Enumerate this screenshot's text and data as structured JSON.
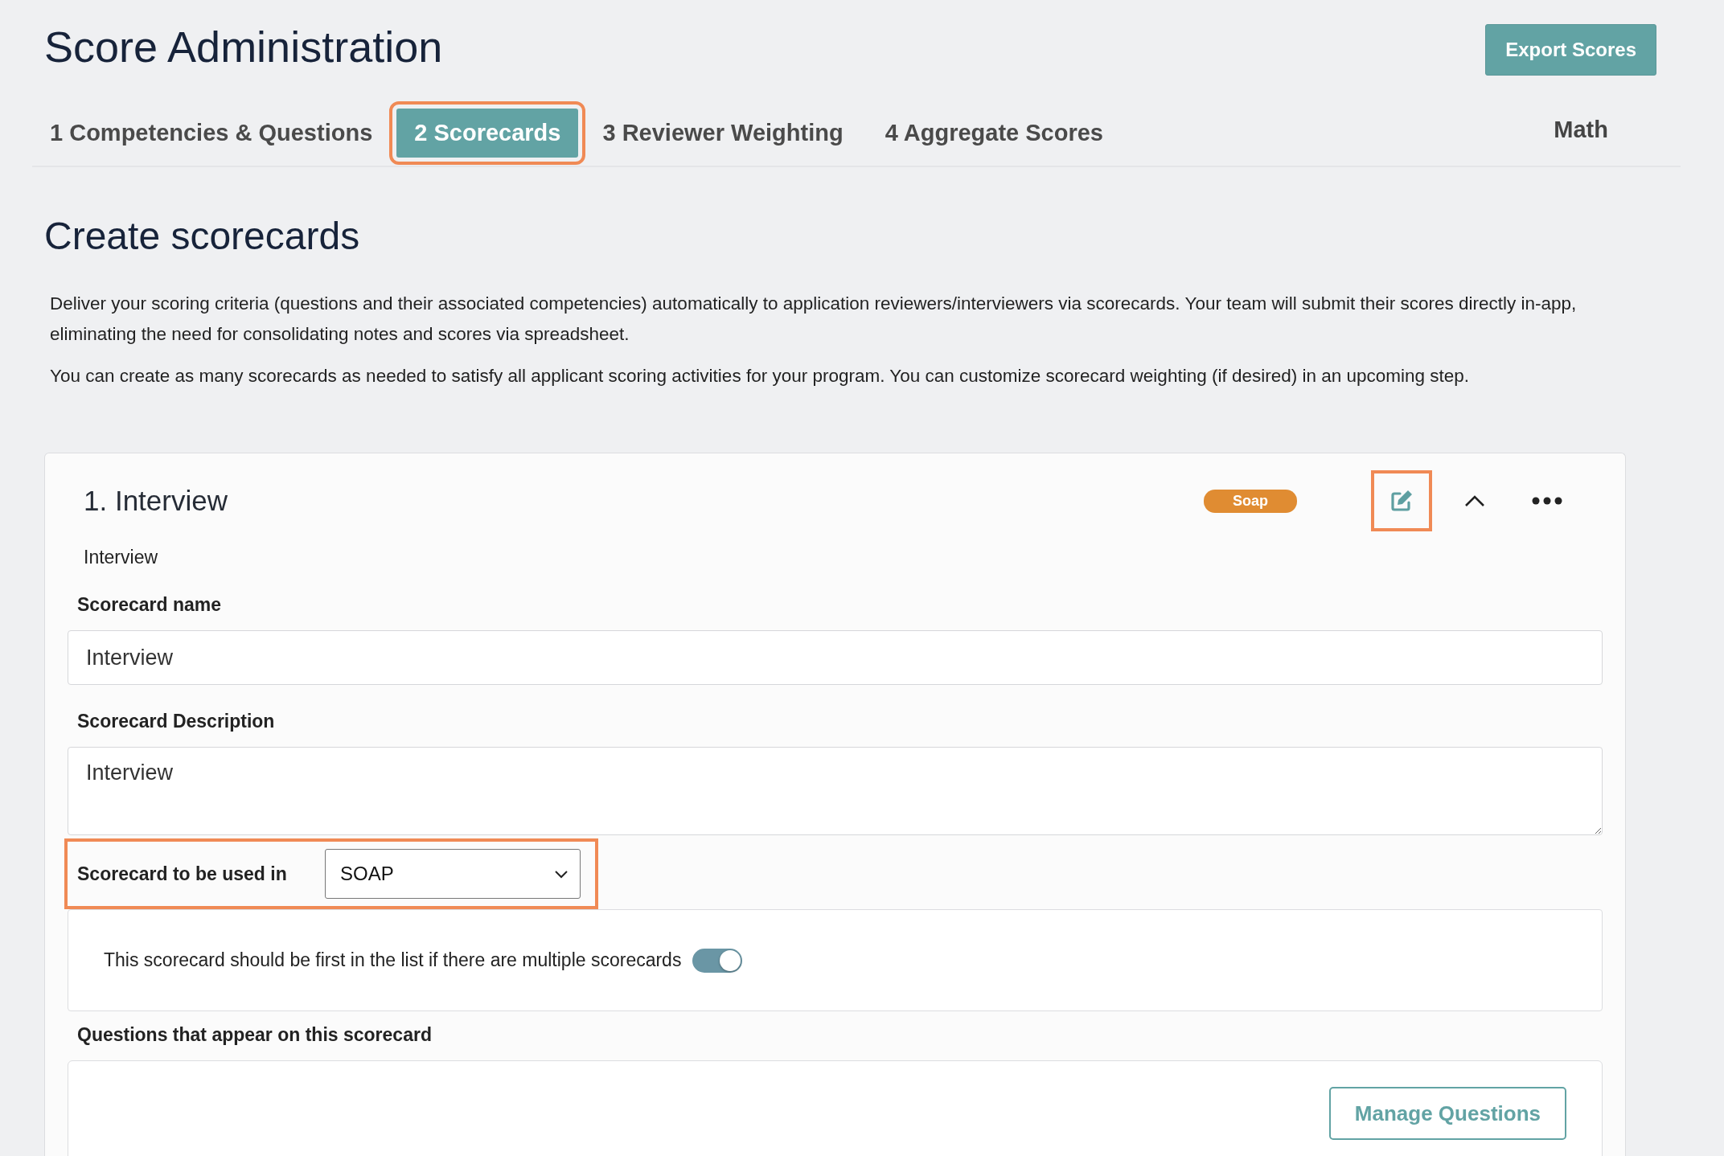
{
  "page": {
    "title": "Score Administration",
    "export_button": "Export Scores"
  },
  "tabs": [
    {
      "label": "1 Competencies & Questions",
      "selected": false,
      "highlighted": false
    },
    {
      "label": "2 Scorecards",
      "selected": true,
      "highlighted": true
    },
    {
      "label": "3 Reviewer Weighting",
      "selected": false,
      "highlighted": false
    },
    {
      "label": "4 Aggregate Scores",
      "selected": false,
      "highlighted": false
    }
  ],
  "program_label": "Math",
  "section": {
    "heading": "Create scorecards",
    "paragraphs": [
      "Deliver your scoring criteria (questions and their associated competencies) automatically to application reviewers/interviewers via scorecards. Your team will submit their scores directly in-app, eliminating the need for consolidating notes and scores via spreadsheet.",
      "You can create as many scorecards as needed to satisfy all applicant scoring activities for your program. You can customize scorecard weighting (if desired) in an upcoming step."
    ]
  },
  "scorecard": {
    "title": "1. Interview",
    "subtitle": "Interview",
    "tag": {
      "label": "Soap",
      "color": "#e08c32"
    },
    "edit_highlighted": true,
    "expanded": true,
    "name_label": "Scorecard name",
    "name_value": "Interview",
    "description_label": "Scorecard Description",
    "description_value": "Interview",
    "used_in_label": "Scorecard to be used in",
    "used_in_value": "SOAP",
    "used_in_highlighted": true,
    "first_label": "This scorecard should be first in the list if there are multiple scorecards",
    "first_on": true,
    "questions_label": "Questions that appear on this scorecard",
    "manage_button": "Manage Questions"
  }
}
